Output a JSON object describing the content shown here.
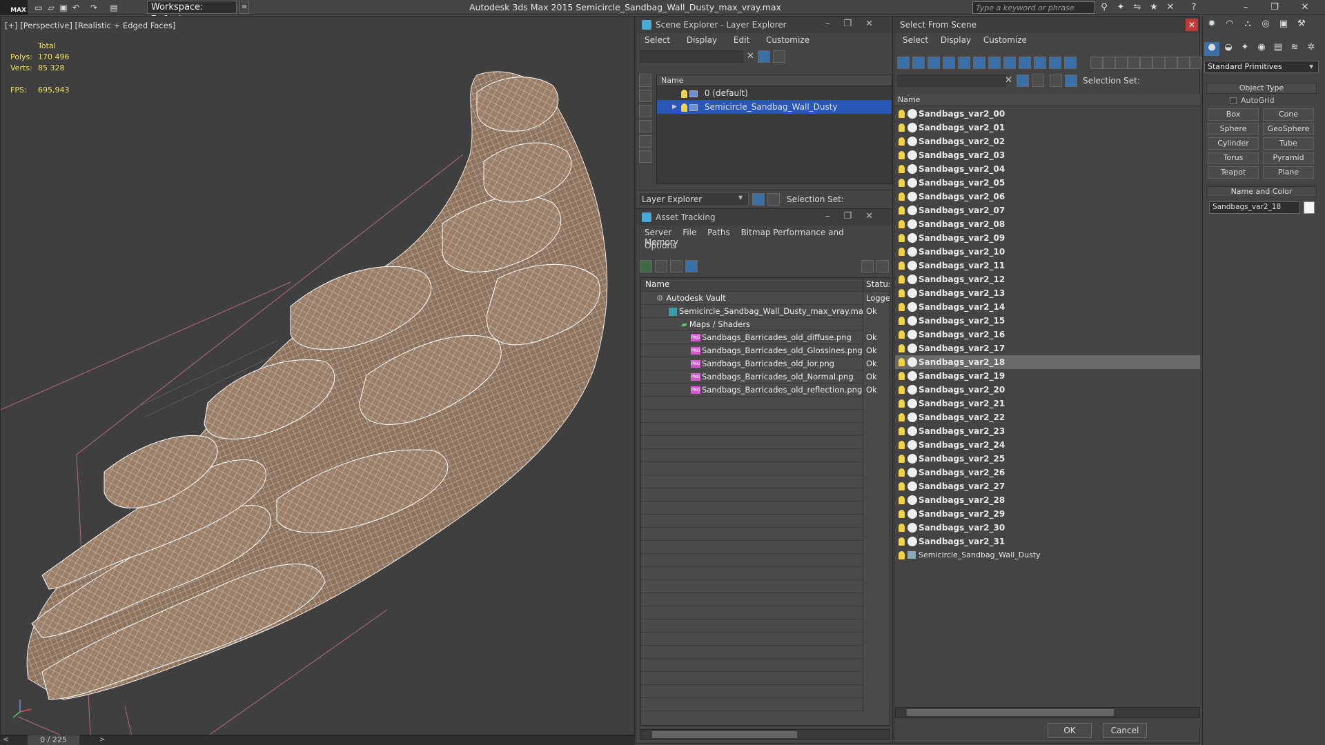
{
  "titlebar": {
    "logo": "MAX",
    "workspace": "Workspace: Default",
    "app_title": "Autodesk 3ds Max  2015     Semicircle_Sandbag_Wall_Dusty_max_vray.max",
    "search_placeholder": "Type a keyword or phrase"
  },
  "viewport": {
    "label": "[+] [Perspective] [Realistic + Edged Faces]",
    "stats": {
      "total_label": "Total",
      "polys_label": "Polys:",
      "polys": "170 496",
      "verts_label": "Verts:",
      "verts": "85 328",
      "fps_label": "FPS:",
      "fps": "695,943"
    }
  },
  "timeline": {
    "position": "0 / 225"
  },
  "scene_explorer": {
    "title": "Scene Explorer - Layer Explorer",
    "menu": [
      "Select",
      "Display",
      "Edit",
      "Customize"
    ],
    "col_name": "Name",
    "layers": [
      {
        "name": "0 (default)",
        "selected": false
      },
      {
        "name": "Semicircle_Sandbag_Wall_Dusty",
        "selected": true
      }
    ],
    "explorer_select": "Layer Explorer",
    "selection_set_label": "Selection Set:"
  },
  "asset_tracking": {
    "title": "Asset Tracking",
    "menu": [
      "Server",
      "File",
      "Paths",
      "Bitmap Performance and Memory"
    ],
    "menu2": "Options",
    "col_name": "Name",
    "col_status": "Status",
    "rows": [
      {
        "name": "Autodesk Vault",
        "status": "Logged",
        "icon": "vault-icon"
      },
      {
        "name": "Semicircle_Sandbag_Wall_Dusty_max_vray.max",
        "status": "Ok",
        "icon": "max-file-icon"
      },
      {
        "name": "Maps / Shaders",
        "status": "",
        "icon": "maps-icon"
      },
      {
        "name": "Sandbags_Barricades_old_diffuse.png",
        "status": "Ok",
        "icon": "png-icon"
      },
      {
        "name": "Sandbags_Barricades_old_Glossines.png",
        "status": "Ok",
        "icon": "png-icon"
      },
      {
        "name": "Sandbags_Barricades_old_ior.png",
        "status": "Ok",
        "icon": "png-icon"
      },
      {
        "name": "Sandbags_Barricades_old_Normal.png",
        "status": "Ok",
        "icon": "png-icon"
      },
      {
        "name": "Sandbags_Barricades_old_reflection.png",
        "status": "Ok",
        "icon": "png-icon"
      }
    ],
    "png_badge": "PNG"
  },
  "select_from_scene": {
    "title": "Select From Scene",
    "menu": [
      "Select",
      "Display",
      "Customize"
    ],
    "selection_set_label": "Selection Set:",
    "col_name": "Name",
    "objects": [
      "Sandbags_var2_00",
      "Sandbags_var2_01",
      "Sandbags_var2_02",
      "Sandbags_var2_03",
      "Sandbags_var2_04",
      "Sandbags_var2_05",
      "Sandbags_var2_06",
      "Sandbags_var2_07",
      "Sandbags_var2_08",
      "Sandbags_var2_09",
      "Sandbags_var2_10",
      "Sandbags_var2_11",
      "Sandbags_var2_12",
      "Sandbags_var2_13",
      "Sandbags_var2_14",
      "Sandbags_var2_15",
      "Sandbags_var2_16",
      "Sandbags_var2_17",
      "Sandbags_var2_18",
      "Sandbags_var2_19",
      "Sandbags_var2_20",
      "Sandbags_var2_21",
      "Sandbags_var2_22",
      "Sandbags_var2_23",
      "Sandbags_var2_24",
      "Sandbags_var2_25",
      "Sandbags_var2_26",
      "Sandbags_var2_27",
      "Sandbags_var2_28",
      "Sandbags_var2_29",
      "Sandbags_var2_30",
      "Sandbags_var2_31"
    ],
    "highlighted": "Sandbags_var2_18",
    "layer_row": "Semicircle_Sandbag_Wall_Dusty",
    "ok": "OK",
    "cancel": "Cancel"
  },
  "command_panel": {
    "dropdown": "Standard Primitives",
    "object_type": "Object Type",
    "autogrid": "AutoGrid",
    "primitives": [
      "Box",
      "Cone",
      "Sphere",
      "GeoSphere",
      "Cylinder",
      "Tube",
      "Torus",
      "Pyramid",
      "Teapot",
      "Plane"
    ],
    "name_and_color": "Name and Color",
    "object_name": "Sandbags_var2_18"
  },
  "colors": {
    "selection_blue": "#2857b6",
    "mesh_fill": "#9b7f69",
    "wire": "#f2ece6",
    "stats_yellow": "#f0e060"
  }
}
